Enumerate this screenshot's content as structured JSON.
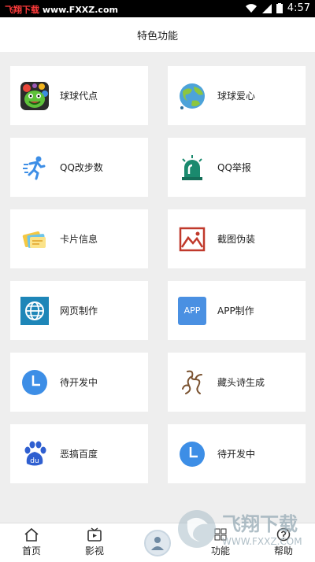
{
  "status_bar": {
    "watermark_prefix": "飞翔下载",
    "watermark_url": "www.FXXZ.com",
    "time": "4:57"
  },
  "header": {
    "title": "特色功能"
  },
  "features": [
    {
      "label": "球球代点",
      "icon": "green-monster-app-icon"
    },
    {
      "label": "球球爱心",
      "icon": "globe-icon"
    },
    {
      "label": "QQ改步数",
      "icon": "running-person-icon"
    },
    {
      "label": "QQ举报",
      "icon": "alarm-siren-icon"
    },
    {
      "label": "卡片信息",
      "icon": "cards-icon"
    },
    {
      "label": "截图伪装",
      "icon": "picture-frame-icon"
    },
    {
      "label": "网页制作",
      "icon": "web-globe-icon"
    },
    {
      "label": "APP制作",
      "icon": "app-badge-icon",
      "badge_text": "APP"
    },
    {
      "label": "待开发中",
      "icon": "clock-icon"
    },
    {
      "label": "藏头诗生成",
      "icon": "calligraphy-icon"
    },
    {
      "label": "恶搞百度",
      "icon": "baidu-paw-icon",
      "badge_text": "du"
    },
    {
      "label": "待开发中",
      "icon": "clock-icon"
    }
  ],
  "tabbar": {
    "home": "首页",
    "video": "影视",
    "function": "功能",
    "help": "帮助"
  },
  "watermark": {
    "text": "飞翔下载",
    "url": "WWW.FXXZ.COM"
  },
  "colors": {
    "accent_blue": "#3d8ee6",
    "content_bg": "#eeeeee"
  }
}
